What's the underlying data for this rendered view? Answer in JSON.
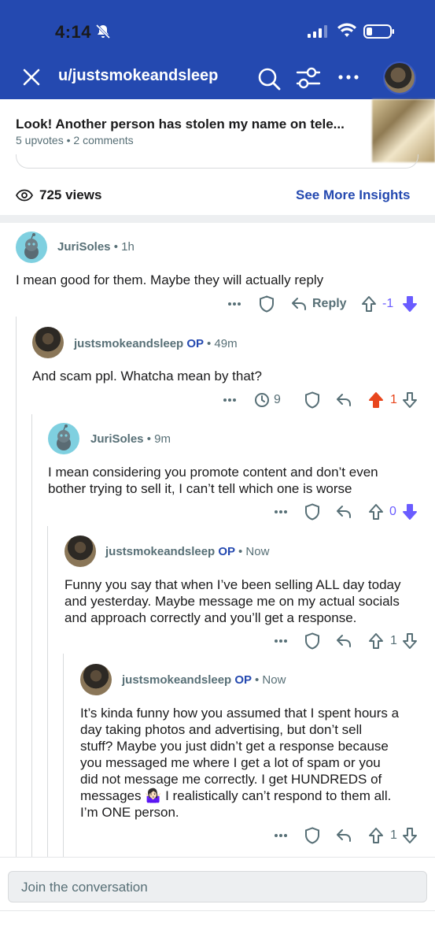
{
  "status": {
    "time": "4:14"
  },
  "header": {
    "title": "u/justsmokeandsleep"
  },
  "post": {
    "title": "Look! Another person has stolen my name on tele...",
    "meta": "5 upvotes • 2 comments"
  },
  "insights": {
    "views": "725 views",
    "link": "See More Insights"
  },
  "comments": [
    {
      "author": "JuriSoles",
      "op": "",
      "time": "1h",
      "lines": [
        "I mean good for them. Maybe they will actually reply"
      ],
      "reply_label": "Reply",
      "votes": "-1",
      "vote_state": "down"
    },
    {
      "author": "justsmokeandsleep",
      "op": "OP",
      "time": "49m",
      "lines": [
        "And scam ppl. Whatcha mean by that?"
      ],
      "awards": "9",
      "votes": "1",
      "vote_state": "up"
    },
    {
      "author": "JuriSoles",
      "op": "",
      "time": "9m",
      "lines": [
        "I mean considering you promote content and don’t even",
        "bother trying to sell it, I can’t tell which one is worse"
      ],
      "votes": "0",
      "vote_state": "down"
    },
    {
      "author": "justsmokeandsleep",
      "op": "OP",
      "time": "Now",
      "lines": [
        "Funny you say that when I’ve been selling ALL day today",
        "and yesterday. Maybe message me on my actual socials",
        "and approach correctly and you’ll get a response."
      ],
      "votes": "1",
      "vote_state": "none"
    },
    {
      "author": "justsmokeandsleep",
      "op": "OP",
      "time": "Now",
      "lines": [
        "It’s kinda funny how you assumed that I spent hours a",
        "day taking photos and advertising, but don’t sell",
        "stuff? Maybe you just didn’t get a response because",
        "you messaged me where I get a lot of spam or you",
        "did not message me correctly. I get HUNDREDS of",
        "messages 🤷🏻‍♀️ I realistically can’t respond to them all.",
        "I’m ONE person."
      ],
      "votes": "1",
      "vote_state": "none"
    }
  ],
  "composer": {
    "placeholder": "Join the conversation"
  },
  "colors": {
    "brand": "#2449b0",
    "upvote": "#e8461d",
    "downvote": "#6a5cff",
    "muted": "#576f76"
  }
}
